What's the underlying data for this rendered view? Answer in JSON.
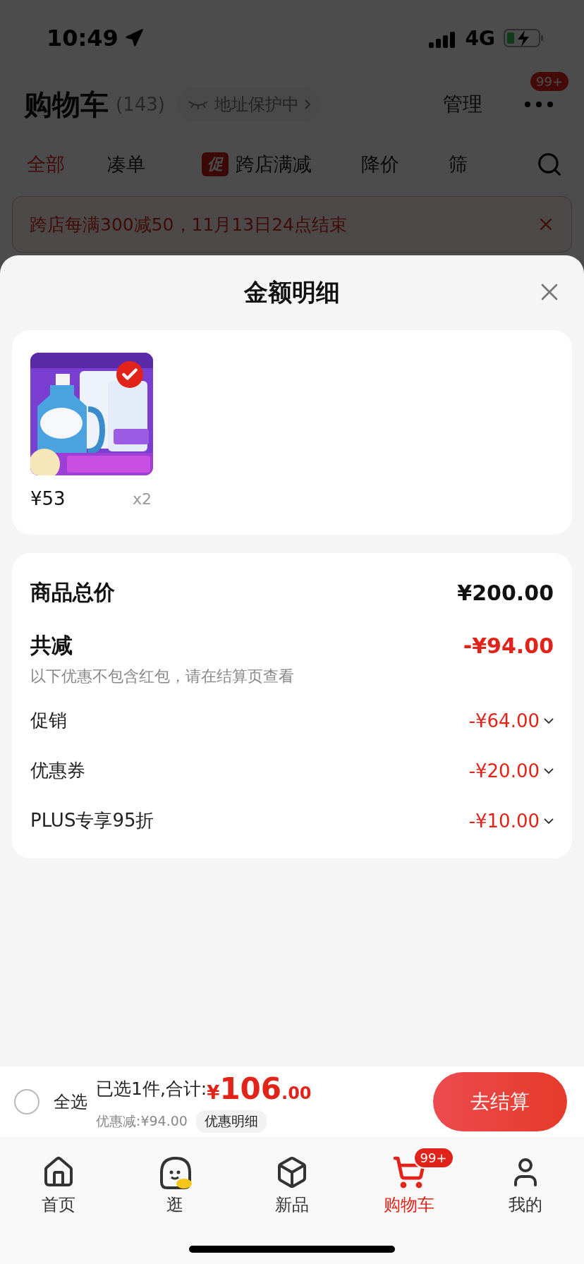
{
  "status_bar": {
    "time": "10:49",
    "network": "4G"
  },
  "header": {
    "title": "购物车",
    "count": "(143)",
    "address_chip": "地址保护中",
    "manage": "管理",
    "more_badge": "99+"
  },
  "tabs": [
    {
      "label": "全部",
      "selected": true
    },
    {
      "label": "凑单",
      "selected": false
    },
    {
      "label": "跨店满减",
      "selected": false,
      "tag": "促"
    },
    {
      "label": "降价",
      "selected": false
    },
    {
      "label": "筛",
      "selected": false
    }
  ],
  "promo_banner": {
    "text": "跨店每满300减50，11月13日24点结束"
  },
  "sheet": {
    "title": "金额明细",
    "items": [
      {
        "kind": "picture",
        "price": "¥53",
        "quantity": "x2",
        "checked": true
      }
    ],
    "summary": {
      "total_label": "商品总价",
      "total": "¥200.00",
      "discount_label": "共减",
      "discount": "-¥94.00",
      "note": "以下优惠不包含红包，请在结算页查看",
      "lines": [
        {
          "label": "促销",
          "amount": "-¥64.00",
          "expanded": false
        },
        {
          "label": "优惠券",
          "amount": "-¥20.00",
          "expanded": false
        },
        {
          "label": "PLUS专享95折",
          "amount": "-¥10.00",
          "expanded": false
        }
      ]
    }
  },
  "checkout_bar": {
    "select_all": {
      "label": "全选",
      "checked": false
    },
    "summary": "已选1件,合计:",
    "currency": "¥",
    "amount_int": "106",
    "amount_dec": ".00",
    "saved": "优惠减:¥94.00",
    "detail_button": "优惠明细",
    "checkout_button": "去结算"
  },
  "nav": [
    {
      "label": "首页",
      "selected": false
    },
    {
      "label": "逛",
      "selected": false
    },
    {
      "label": "新品",
      "selected": false
    },
    {
      "label": "购物车",
      "selected": true,
      "badge": "99+"
    },
    {
      "label": "我的",
      "selected": false
    }
  ]
}
